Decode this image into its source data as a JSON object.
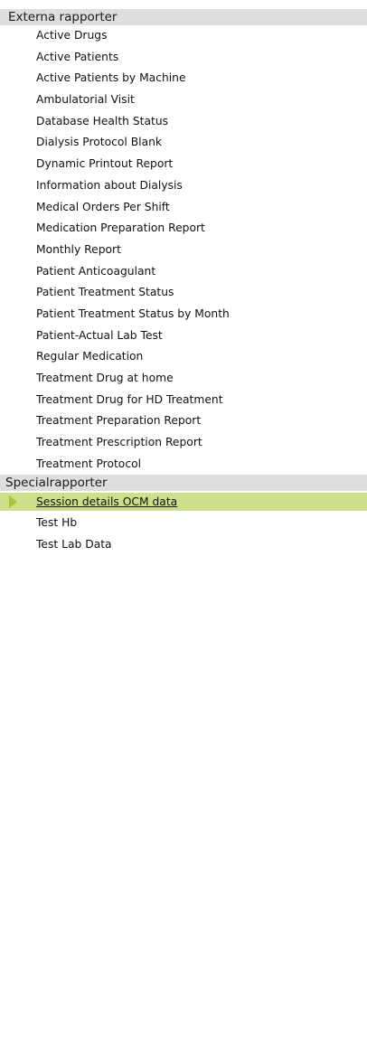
{
  "groups": [
    {
      "title": "Externa rapporter",
      "items": [
        "Active Drugs",
        "Active Patients",
        "Active Patients by Machine",
        "Ambulatorial Visit",
        "Database Health Status",
        "Dialysis Protocol Blank",
        "Dynamic Printout Report",
        "Information about Dialysis",
        "Medical Orders Per Shift",
        "Medication Preparation Report",
        "Monthly Report",
        "Patient Anticoagulant",
        "Patient Treatment Status",
        "Patient Treatment Status by Month",
        "Patient-Actual Lab Test",
        "Regular Medication",
        "Treatment Drug at home",
        "Treatment Drug for HD Treatment",
        "Treatment Preparation Report",
        "Treatment Prescription Report",
        "Treatment Protocol"
      ]
    },
    {
      "title": "Specialrapporter",
      "items": [
        "Session details OCM data",
        "Test Hb",
        "Test Lab Data"
      ],
      "selected_item": "Session details OCM data"
    }
  ],
  "colors": {
    "header_background": "#dedede",
    "selected_background": "#cedf8a",
    "selection_arrow": "#a7c33f"
  },
  "icons": {
    "selected_marker": "selection-arrow-icon"
  }
}
